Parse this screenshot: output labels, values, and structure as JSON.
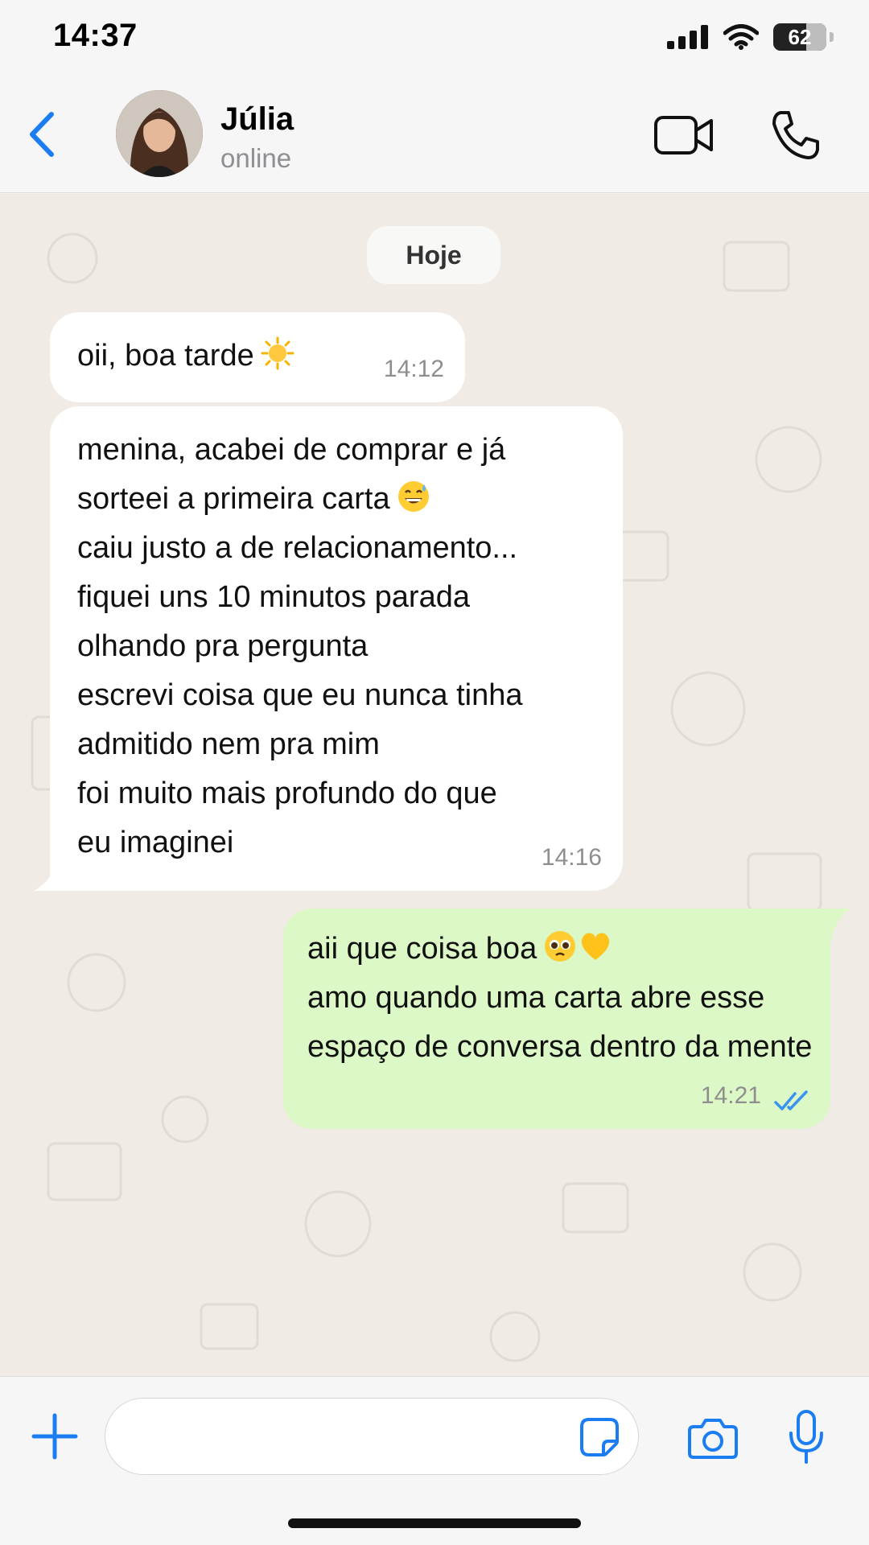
{
  "status_bar": {
    "time": "14:37",
    "battery": "62",
    "battery_level_percent": 62
  },
  "header": {
    "contact_name": "Júlia",
    "contact_status": "online"
  },
  "chat": {
    "date_label": "Hoje",
    "messages": [
      {
        "direction": "incoming",
        "lines": [
          "oii, boa tarde"
        ],
        "emoji": [
          "sun"
        ],
        "time": "14:12"
      },
      {
        "direction": "incoming",
        "lines": [
          "menina, acabei de comprar e já",
          "sorteei a primeira carta",
          "caiu justo a de relacionamento...",
          "fiquei uns 10 minutos parada",
          "olhando pra pergunta",
          "escrevi coisa que eu nunca tinha",
          "admitido nem pra mim",
          "foi muito mais profundo do que",
          "eu imaginei"
        ],
        "emoji": [
          "grinning-sweat"
        ],
        "time": "14:16"
      },
      {
        "direction": "outgoing",
        "lines": [
          "aii que coisa boa",
          "amo quando uma carta abre esse",
          "espaço de conversa dentro da mente"
        ],
        "emoji": [
          "pleading-face",
          "yellow-heart"
        ],
        "time": "14:21",
        "read": true
      }
    ]
  },
  "input": {
    "value": "",
    "placeholder": ""
  },
  "colors": {
    "accent": "#1a7ef2",
    "outgoing_bubble": "#dcf8c6",
    "incoming_bubble": "#ffffff",
    "chat_background": "#f0ebe5",
    "read_ticks": "#3a93f0"
  },
  "icons": [
    "back-chevron-icon",
    "video-camera-icon",
    "phone-icon",
    "plus-icon",
    "sticker-icon",
    "camera-icon",
    "microphone-icon",
    "signal-icon",
    "wifi-icon",
    "battery-icon",
    "double-check-icon"
  ]
}
